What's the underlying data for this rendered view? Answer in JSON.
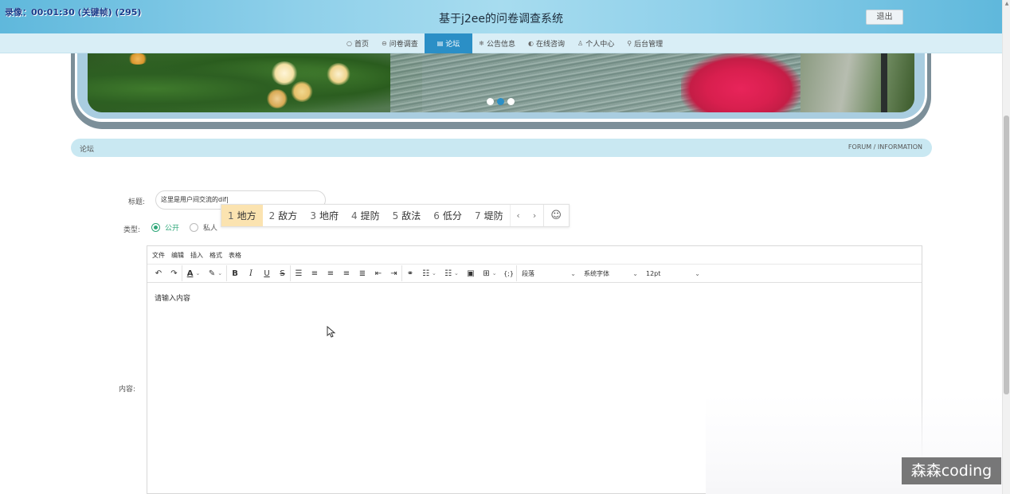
{
  "recorder": {
    "text": "录像：00:01:30 (关键帧) (295)"
  },
  "header": {
    "title": "基于j2ee的问卷调查系统",
    "logout_label": "退出"
  },
  "nav": {
    "items": [
      {
        "icon": "○",
        "label": "首页"
      },
      {
        "icon": "⊖",
        "label": "问卷调查"
      },
      {
        "icon": "▤",
        "label": "论坛"
      },
      {
        "icon": "❄",
        "label": "公告信息"
      },
      {
        "icon": "◐",
        "label": "在线咨询"
      },
      {
        "icon": "♙",
        "label": "个人中心"
      },
      {
        "icon": "⚲",
        "label": "后台管理"
      }
    ],
    "active": "论坛"
  },
  "banner": {
    "slide_count": 3,
    "active_slide": 2
  },
  "section": {
    "left": "论坛",
    "right": "FORUM / INFORMATION"
  },
  "form": {
    "title_label": "标题:",
    "title_value": "这里是用户间交流的dif|",
    "type_label": "类型:",
    "type_options": [
      "公开",
      "私人"
    ],
    "type_selected": "公开",
    "content_label": "内容:"
  },
  "ime": {
    "candidates": [
      {
        "n": "1",
        "text": "地方"
      },
      {
        "n": "2",
        "text": "敌方"
      },
      {
        "n": "3",
        "text": "地府"
      },
      {
        "n": "4",
        "text": "提防"
      },
      {
        "n": "5",
        "text": "敌法"
      },
      {
        "n": "6",
        "text": "低分"
      },
      {
        "n": "7",
        "text": "堤防"
      }
    ],
    "prev": "‹",
    "next": "›",
    "emoji": "☺"
  },
  "editor": {
    "menu": [
      "文件",
      "编辑",
      "插入",
      "格式",
      "表格"
    ],
    "block_format": "段落",
    "font_family": "系统字体",
    "font_size": "12pt",
    "placeholder": "请输入内容"
  },
  "watermark": "森森coding"
}
